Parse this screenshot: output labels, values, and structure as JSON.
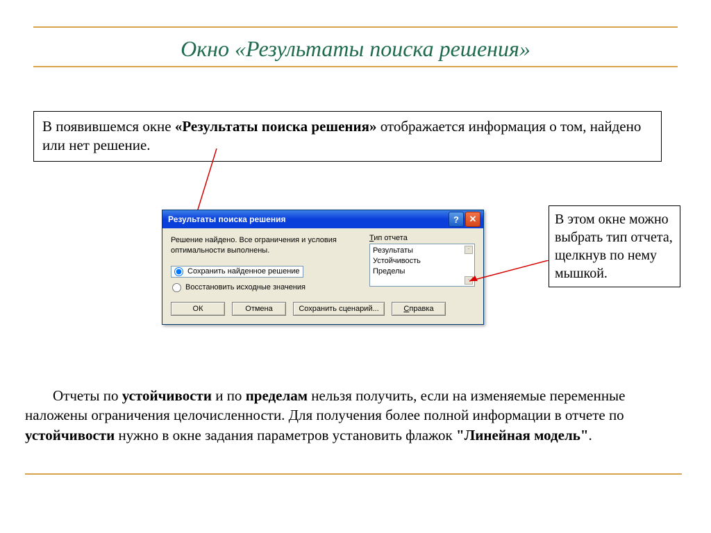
{
  "title": "Окно «Результаты  поиска решения»",
  "intro": {
    "pre": "В появившемся окне ",
    "bold": "«Результаты поиска решения»",
    "post": " отображается информация о том, найдено или нет решение."
  },
  "dialog": {
    "title": "Результаты поиска решения",
    "help_glyph": "?",
    "close_glyph": "✕",
    "status": "Решение найдено. Все ограничения и условия оптимальности выполнены.",
    "radio_save": "Сохранить найденное решение",
    "radio_restore": "Восстановить исходные значения",
    "report_label_pre": "Т",
    "report_label_post": "ип отчета",
    "report_items": [
      "Результаты",
      "Устойчивость",
      "Пределы"
    ],
    "btn_ok": "ОК",
    "btn_cancel": "Отмена",
    "btn_scenario": "Сохранить сценарий...",
    "btn_help_pre": "С",
    "btn_help_post": "правка"
  },
  "side_note": "В этом окне можно выбрать тип отчета, щелкнув по нему мышкой.",
  "bottom": {
    "t1": "Отчеты по ",
    "b1": "устойчивости",
    "t2": " и по ",
    "b2": "пределам",
    "t3": " нельзя получить, если на изменяемые переменные наложены ограничения целочисленности. Для получения более полной информации в отчете по ",
    "b3": "устойчивости",
    "t4": " нужно в окне задания параметров установить флажок ",
    "b4": "\"Линейная модель\"",
    "t5": "."
  }
}
